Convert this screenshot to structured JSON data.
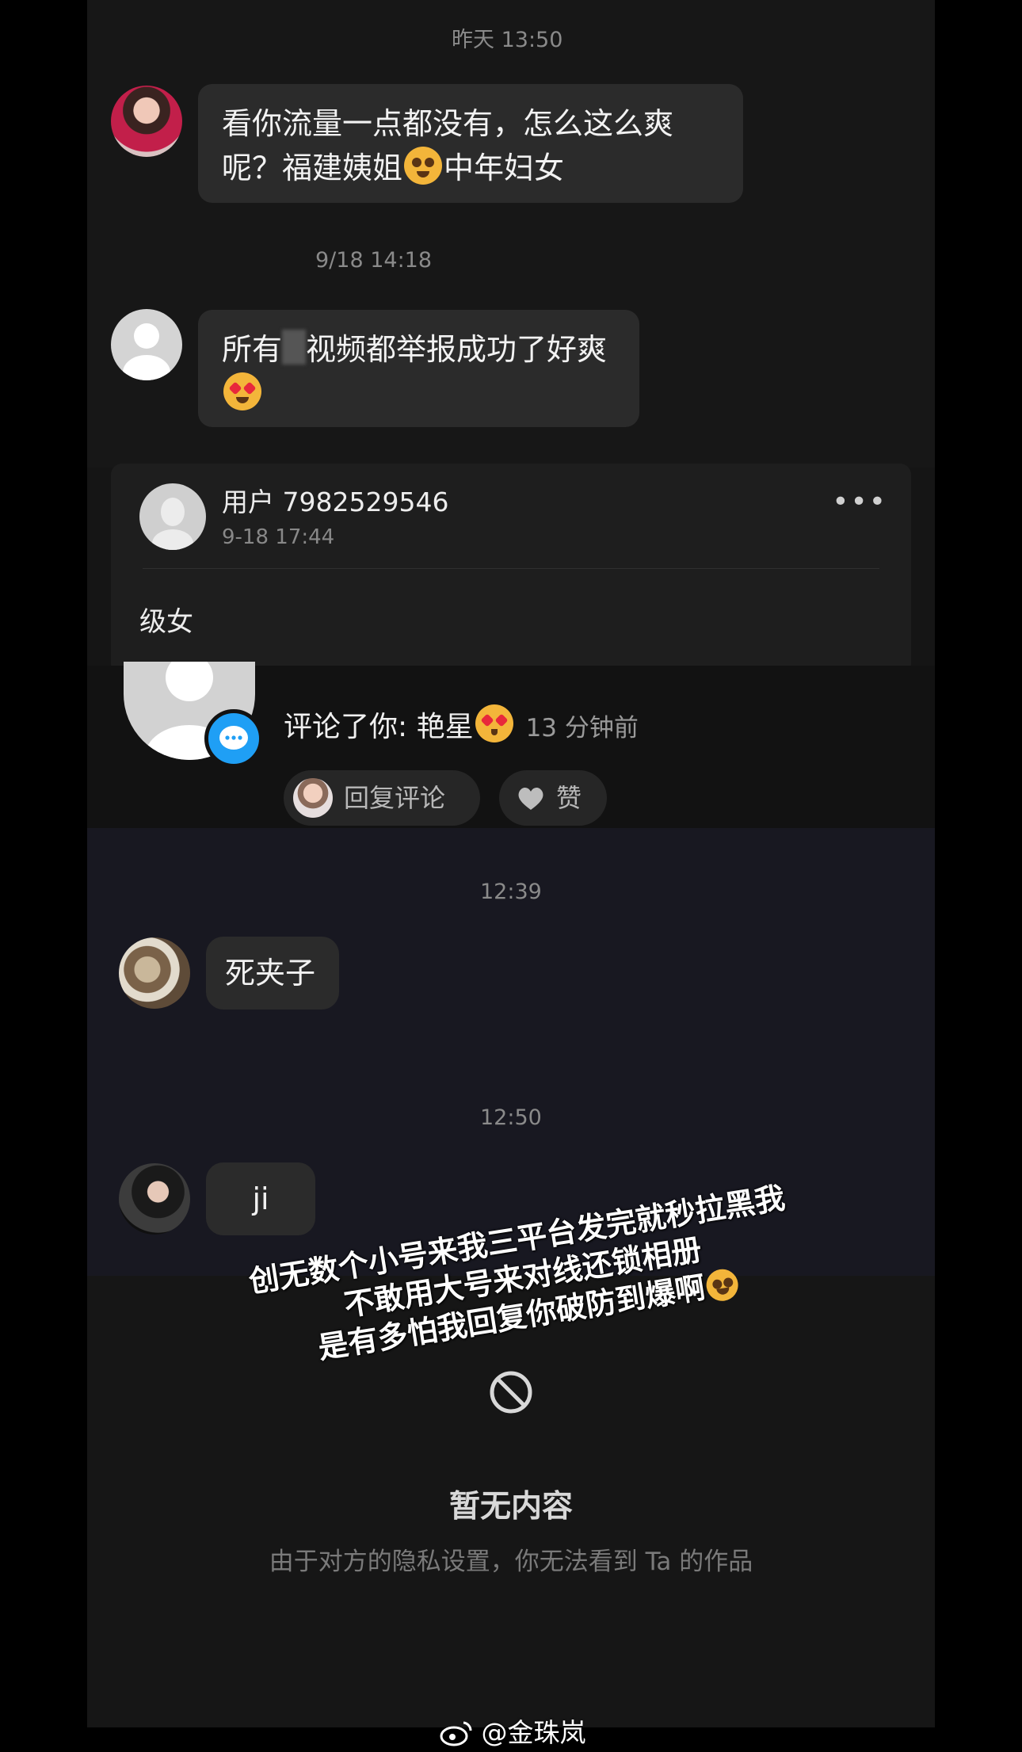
{
  "chat1": {
    "timestamp_1": "昨天 13:50",
    "message_1_text": "看你流量一点都没有，怎么这么爽呢？福建姨姐",
    "message_1_suffix": "中年妇女",
    "timestamp_2": "9/18 14:18",
    "message_2_prefix": "所有",
    "message_2_text": "视频都举报成功了好爽"
  },
  "comment_card": {
    "username": "用户 7982529546",
    "time": "9-18 17:44",
    "more_icon": "more-dots-icon",
    "body": "级女"
  },
  "notification": {
    "action_text": "评论了你: 艳星",
    "time_ago": "13 分钟前",
    "reply_label": "回复评论",
    "like_label": "赞"
  },
  "chat2": {
    "timestamp_1": "12:39",
    "message_1_text": "死夹子",
    "timestamp_2": "12:50",
    "message_2_text": "ji"
  },
  "overlay": {
    "line_1": "创无数个小号来我三平台发完就秒拉黑我",
    "line_2": "不敢用大号来对线还锁相册",
    "line_3": "是有多怕我回复你破防到爆啊"
  },
  "empty_state": {
    "icon": "no-entry-icon",
    "title": "暂无内容",
    "subtitle": "由于对方的隐私设置，你无法看到 Ta 的作品"
  },
  "watermark": {
    "handle": "@金珠岚",
    "icon": "weibo-icon"
  },
  "colors": {
    "bubble": "#2b2b2b",
    "badge_blue": "#1f9ff5",
    "background": "#151515"
  }
}
